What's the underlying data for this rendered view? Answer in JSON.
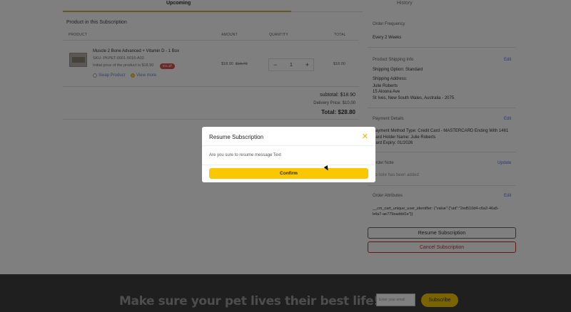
{
  "tabs": {
    "upcoming": "Upcoming",
    "history": "History"
  },
  "products": {
    "section_title": "Product in this Subscription",
    "headers": [
      "PRODUCT",
      "AMOUNT",
      "QUANTITY",
      "TOTAL"
    ],
    "item": {
      "name": "Muscle 2 Bone Advanced + Vitamin D - 1 Box",
      "sku": "SKU: PKPET-0001-5016-A02",
      "initial_price": "Initial price of the product is $18.90",
      "badge": "5% off",
      "swap_label": "Swap Product",
      "view_label": "View more",
      "amount": "$18.90",
      "amount_old": "$19.79",
      "quantity": "1",
      "total": "$18.90"
    },
    "subtotal": "subtotal: $18.90",
    "delivery": "Delivery Price: $10.00",
    "total": "Total: $28.80"
  },
  "sidebar": {
    "order_frequency_label": "Order Frequency",
    "order_frequency_value": "Every 2 Weeks",
    "shipping_label": "Product Shipping Info",
    "shipping_edit": "Edit",
    "shipping_option": "Shipping Option: Standard",
    "shipping_address_label": "Shipping Address:",
    "address_line1": "Julie Roberts",
    "address_line2": "15 Aloona Ave",
    "address_line3": "St Ives, New South Wales, Australia - 2075",
    "payment_label": "Payment Details",
    "payment_edit": "Edit",
    "payment_method": "Payment Method Type: Credit Card - MASTERCARD Ending With 1461",
    "card_holder": "Card Holder Name: Julie Roberts",
    "card_expiry": "Card Expiry: 01/2026",
    "order_note_label": "Order Note",
    "order_note_update": "Update",
    "order_note_value": "no note has been added",
    "attributes_label": "Order Attributes",
    "attributes_edit": "Edit",
    "attributes_line1": "__cm_cart_unique_user_identifier: {\"value\":{\"uid\":\"2ed510d4-c6a2-46a5-",
    "attributes_line2": "b4a7-ae779eaddd1e\"}}",
    "resume_button": "Resume Subscription",
    "cancel_button": "Cancel Subscription"
  },
  "footer": {
    "title": "Make sure your pet lives their best life!",
    "email_placeholder": "Enter your email",
    "subscribe_button": "Subscribe"
  },
  "modal": {
    "title": "Resume Subscription",
    "close_glyph": "✕",
    "body": "Are you sure to resume message Text",
    "confirm": "Confirm"
  },
  "colors": {
    "accent": "#f9c800",
    "close_icon": "#f0b400",
    "cancel": "#c9302c",
    "link": "#5a73d6",
    "footer_bg": "#3e3e3e"
  }
}
